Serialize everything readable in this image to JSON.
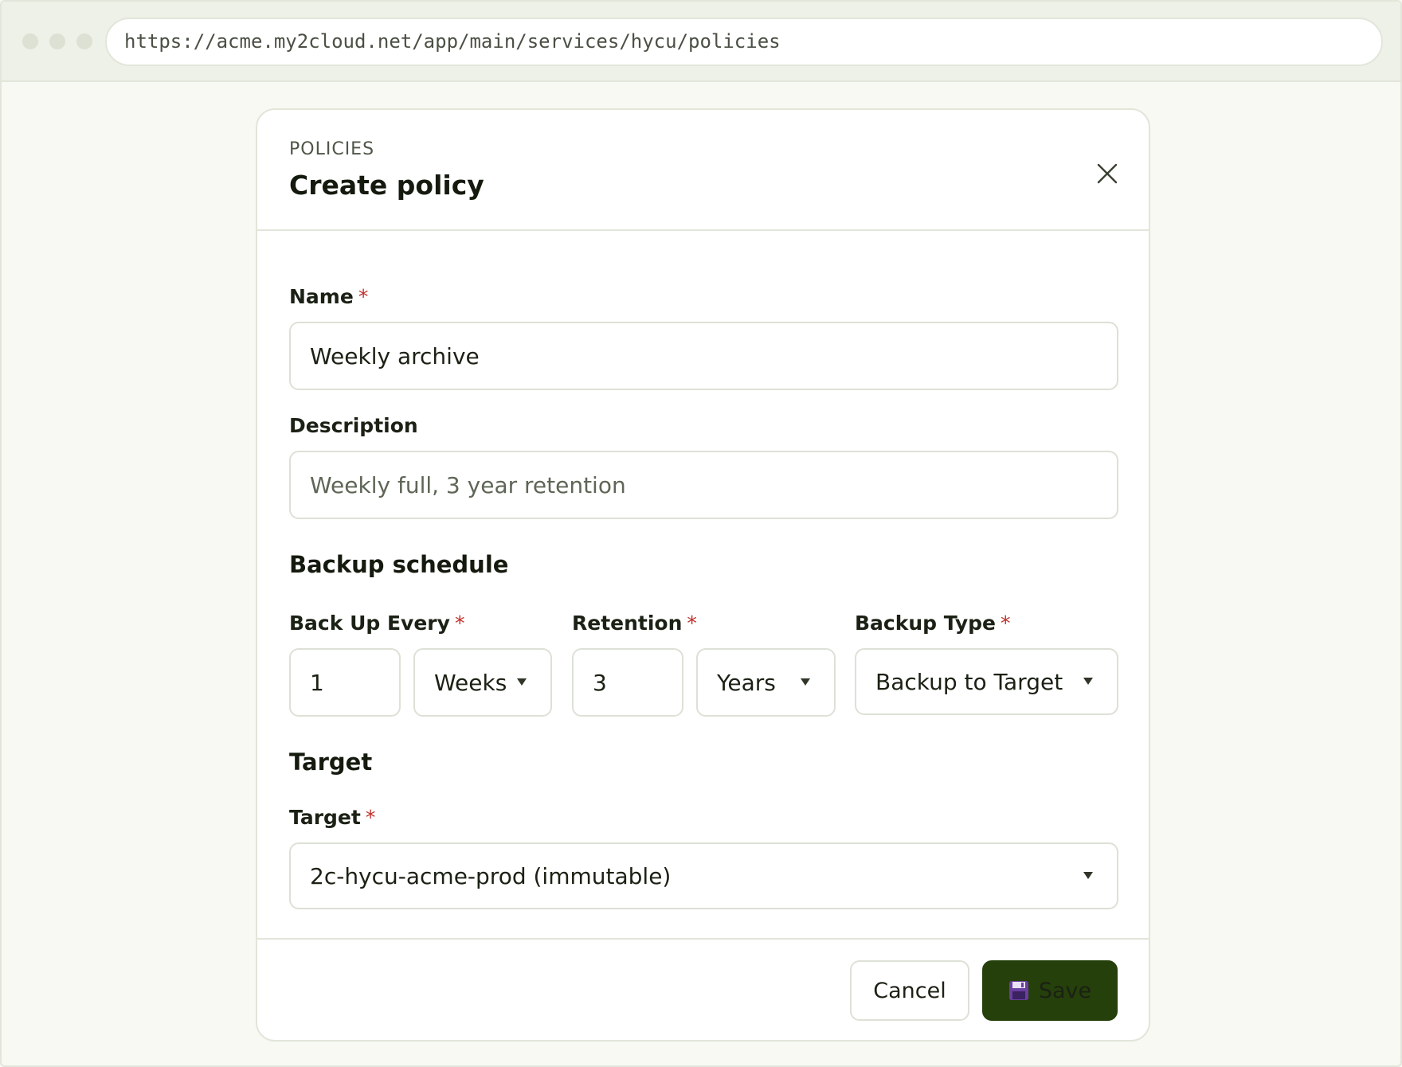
{
  "browser": {
    "url": "https://acme.my2cloud.net/app/main/services/hycu/policies"
  },
  "modal": {
    "eyebrow": "POLICIES",
    "title": "Create policy",
    "close_icon": "close-icon"
  },
  "form": {
    "name": {
      "label": "Name",
      "required_mark": "*",
      "value": "Weekly archive"
    },
    "description": {
      "label": "Description",
      "placeholder": "Weekly full, 3 year retention"
    },
    "backup_schedule": {
      "heading": "Backup schedule",
      "back_up_every": {
        "label": "Back Up Every",
        "required_mark": "*",
        "value": "1",
        "unit": "Weeks"
      },
      "retention": {
        "label": "Retention",
        "required_mark": "*",
        "value": "3",
        "unit": "Years"
      },
      "backup_type": {
        "label": "Backup Type",
        "required_mark": "*",
        "value": "Backup to Target"
      }
    },
    "target_section": {
      "heading": "Target",
      "target": {
        "label": "Target",
        "required_mark": "*",
        "value": "2c-hycu-acme-prod (immutable)"
      }
    }
  },
  "footer": {
    "cancel_label": "Cancel",
    "save_label": "Save",
    "save_icon": "floppy-disk-icon"
  },
  "colors": {
    "primary_button": "#25400b",
    "required": "#c0312b",
    "page_background": "#f8f9f2"
  }
}
